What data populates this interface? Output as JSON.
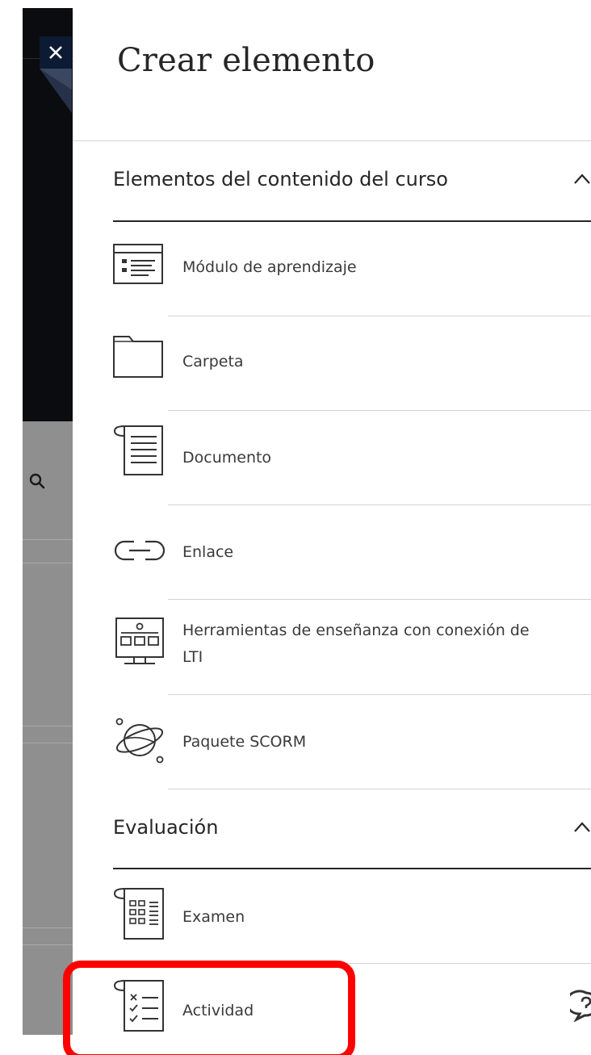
{
  "panel": {
    "title": "Crear elemento",
    "close_label": "×"
  },
  "sections": [
    {
      "title": "Elementos del contenido del curso",
      "expanded": true,
      "items": [
        {
          "label": "Módulo de aprendizaje",
          "icon": "learning-module-icon"
        },
        {
          "label": "Carpeta",
          "icon": "folder-icon"
        },
        {
          "label": "Documento",
          "icon": "document-icon"
        },
        {
          "label": "Enlace",
          "icon": "link-icon"
        },
        {
          "label": "Herramientas de enseñanza con conexión de",
          "label_line2": "LTI",
          "icon": "lti-tool-icon"
        },
        {
          "label": "Paquete SCORM",
          "icon": "scorm-package-icon"
        }
      ]
    },
    {
      "title": "Evaluación",
      "expanded": true,
      "items": [
        {
          "label": "Examen",
          "icon": "test-icon"
        },
        {
          "label": "Actividad",
          "icon": "assignment-icon"
        }
      ]
    }
  ],
  "background": {
    "search_icon": "search-icon"
  },
  "colors": {
    "close_button_bg": "#0d1a33",
    "highlight": "#ff0000",
    "text": "#262626"
  }
}
